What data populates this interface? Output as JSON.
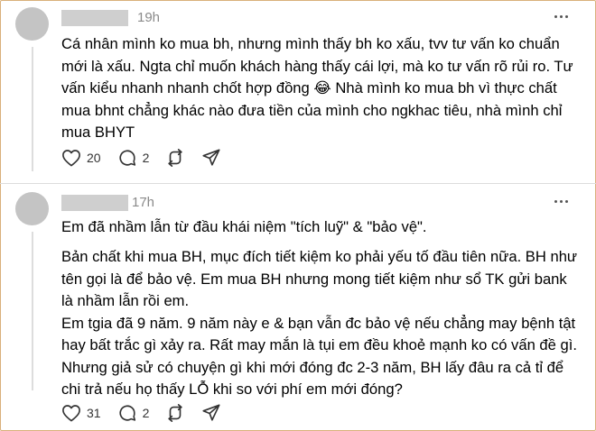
{
  "posts": [
    {
      "time": "19h",
      "paragraphs": [
        "Cá nhân mình ko mua bh, nhưng mình thấy bh ko xấu, tvv tư vấn ko chuẩn mới là xấu. Ngta chỉ muốn khách hàng thấy cái lợi, mà ko tư vấn rõ rủi ro. Tư vấn kiểu nhanh nhanh chốt hợp đồng 😂 Nhà mình ko mua bh vì thực chất mua bhnt chẳng khác nào đưa tiền của mình cho ngkhac tiêu, nhà mình chỉ mua BHYT"
      ],
      "likes": "20",
      "replies": "2"
    },
    {
      "time": "17h",
      "paragraphs": [
        "Em đã nhầm lẫn từ đầu khái niệm \"tích luỹ\" & \"bảo vệ\".",
        "Bản chất khi mua BH, mục đích tiết kiệm ko phải yếu tố đầu tiên nữa. BH như tên gọi là để bảo vệ. Em mua BH nhưng mong tiết kiệm như sổ TK gửi bank là nhầm lẫn rồi em.\nEm tgia đã 9 năm. 9 năm này e & bạn vẫn đc bảo vệ nếu chẳng may bệnh tật hay bất trắc gì xảy ra. Rất may mắn là tụi em đều khoẻ mạnh ko có vấn đề gì. Nhưng giả sử có chuyện gì khi mới đóng đc 2-3 năm, BH lấy đâu ra cả tỉ để chi trả nếu họ thấy LỖ khi so với phí em mới đóng?"
      ],
      "likes": "31",
      "replies": "2"
    }
  ],
  "icons": {
    "like": "heart-icon",
    "reply": "comment-icon",
    "repost": "repost-icon",
    "share": "share-icon",
    "more": "more-icon"
  }
}
